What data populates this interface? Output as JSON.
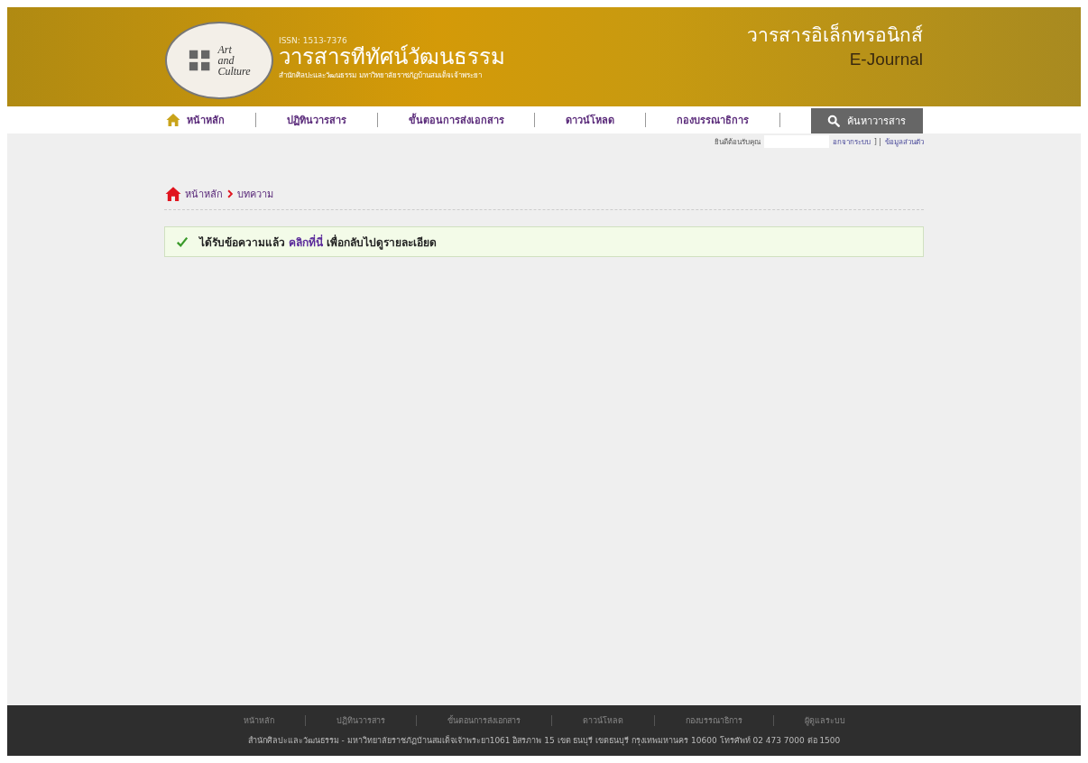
{
  "header": {
    "logo_text": [
      "Art",
      "and",
      "Culture"
    ],
    "issn": "ISSN: 1513-7376",
    "title": "วารสารทีทัศน์วัฒนธรรม",
    "subtitle": "สำนักศิลปะและวัฒนธรรม มหาวิทยาลัยราชภัฏบ้านสมเด็จเจ้าพระยา",
    "ejournal_thai": "วารสารอิเล็กทรอนิกส์",
    "ejournal": "E-Journal"
  },
  "nav": {
    "items": [
      {
        "label": "หน้าหลัก"
      },
      {
        "label": "ปฏิทินวารสาร"
      },
      {
        "label": "ขั้นตอนการส่งเอกสาร"
      },
      {
        "label": "ดาวน์โหลด"
      },
      {
        "label": "กองบรรณาธิการ"
      }
    ],
    "search_button": "ค้นหาวารสาร"
  },
  "user_bar": {
    "welcome": "ยินดีต้อนรับคุณ",
    "logout": "อกจากระบบ",
    "separator": "] |",
    "profile": "ข้อมูลส่วนตัว"
  },
  "breadcrumb": [
    {
      "label": "หน้าหลัก"
    },
    {
      "label": "บทความ"
    }
  ],
  "alert": {
    "before": "ได้รับข้อความแล้ว",
    "link": "คลิกที่นี่",
    "after": "เพื่อกลับไปดูรายละเอียด"
  },
  "footer": {
    "links": [
      "หน้าหลัก",
      "ปฏิทินวารสาร",
      "ขั้นตอนการส่งเอกสาร",
      "ดาวน์โหลด",
      "กองบรรณาธิการ",
      "ผู้ดูแลระบบ"
    ],
    "address": "สำนักศิลปะและวัฒนธรรม - มหาวิทยาลัยราชภัฏบ้านสมเด็จเจ้าพระยา1061 อิสรภาพ 15 เขต ธนบุรี เขตธนบุรี กรุงเทพมหานคร 10600 โทรศัพท์ 02 473 7000 ต่อ 1500"
  }
}
